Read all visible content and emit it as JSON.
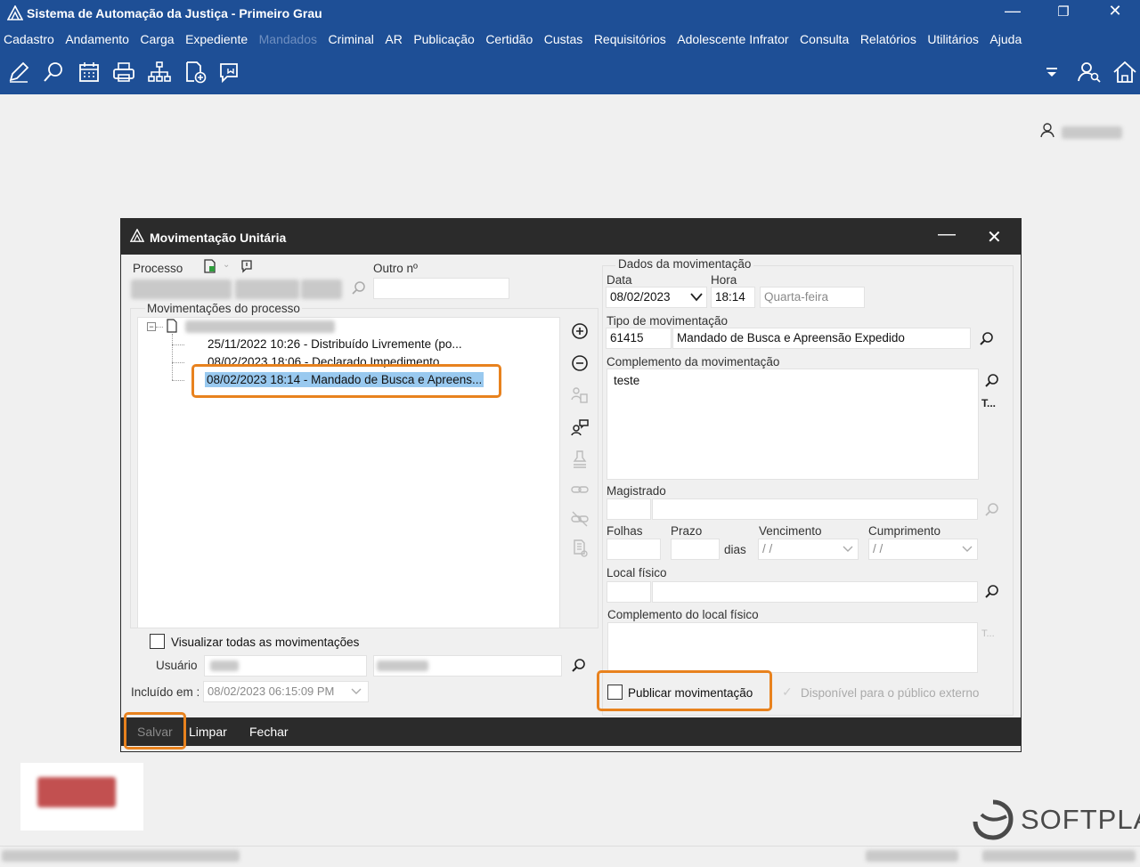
{
  "window": {
    "title": "Sistema de Automação da Justiça - Primeiro Grau"
  },
  "menu": [
    {
      "label": "Cadastro",
      "disabled": false
    },
    {
      "label": "Andamento",
      "disabled": false
    },
    {
      "label": "Carga",
      "disabled": false
    },
    {
      "label": "Expediente",
      "disabled": false
    },
    {
      "label": "Mandados",
      "disabled": true
    },
    {
      "label": "Criminal",
      "disabled": false
    },
    {
      "label": "AR",
      "disabled": false
    },
    {
      "label": "Publicação",
      "disabled": false
    },
    {
      "label": "Certidão",
      "disabled": false
    },
    {
      "label": "Custas",
      "disabled": false
    },
    {
      "label": "Requisitórios",
      "disabled": false
    },
    {
      "label": "Adolescente Infrator",
      "disabled": false
    },
    {
      "label": "Consulta",
      "disabled": false
    },
    {
      "label": "Relatórios",
      "disabled": false
    },
    {
      "label": "Utilitários",
      "disabled": false
    },
    {
      "label": "Ajuda",
      "disabled": false
    }
  ],
  "dialog": {
    "title": "Movimentação Unitária",
    "left": {
      "processo_label": "Processo",
      "outro_label": "Outro nº",
      "movimentacoes_label": "Movimentações do processo",
      "tree_items": [
        "25/11/2022 10:26 - Distribuído Livremente (po...",
        "08/02/2023 18:06 - Declarado Impedimento",
        "08/02/2023 18:14 - Mandado de Busca e Apreens..."
      ],
      "visualizar_label": "Visualizar todas as movimentações",
      "usuario_label": "Usuário",
      "incluido_label": "Incluído em :",
      "incluido_value": "08/02/2023 06:15:09 PM"
    },
    "right": {
      "group_label": "Dados da movimentação",
      "data_label": "Data",
      "data_value": "08/02/2023",
      "hora_label": "Hora",
      "hora_value": "18:14",
      "weekday": "Quarta-feira",
      "tipo_label": "Tipo de movimentação",
      "tipo_code": "61415",
      "tipo_desc": "Mandado de Busca e Apreensão Expedido",
      "complemento_label": "Complemento da movimentação",
      "complemento_value": "teste",
      "text_btn": "T...",
      "magistrado_label": "Magistrado",
      "folhas_label": "Folhas",
      "prazo_label": "Prazo",
      "dias_label": "dias",
      "vencimento_label": "Vencimento",
      "vencimento_value": "/ /",
      "cumprimento_label": "Cumprimento",
      "cumprimento_value": "/ /",
      "local_label": "Local físico",
      "comp_local_label": "Complemento do local físico",
      "publicar_label": "Publicar movimentação",
      "disponivel_label": "Disponível para o público externo"
    },
    "footer": {
      "salvar": "Salvar",
      "limpar": "Limpar",
      "fechar": "Fechar"
    }
  },
  "brand": "SOFTPLAN",
  "colors": {
    "menubar": "#1e4f96",
    "highlight": "#e8821e",
    "selection": "#99c9ef",
    "dialog_title": "#2b2b2b"
  }
}
